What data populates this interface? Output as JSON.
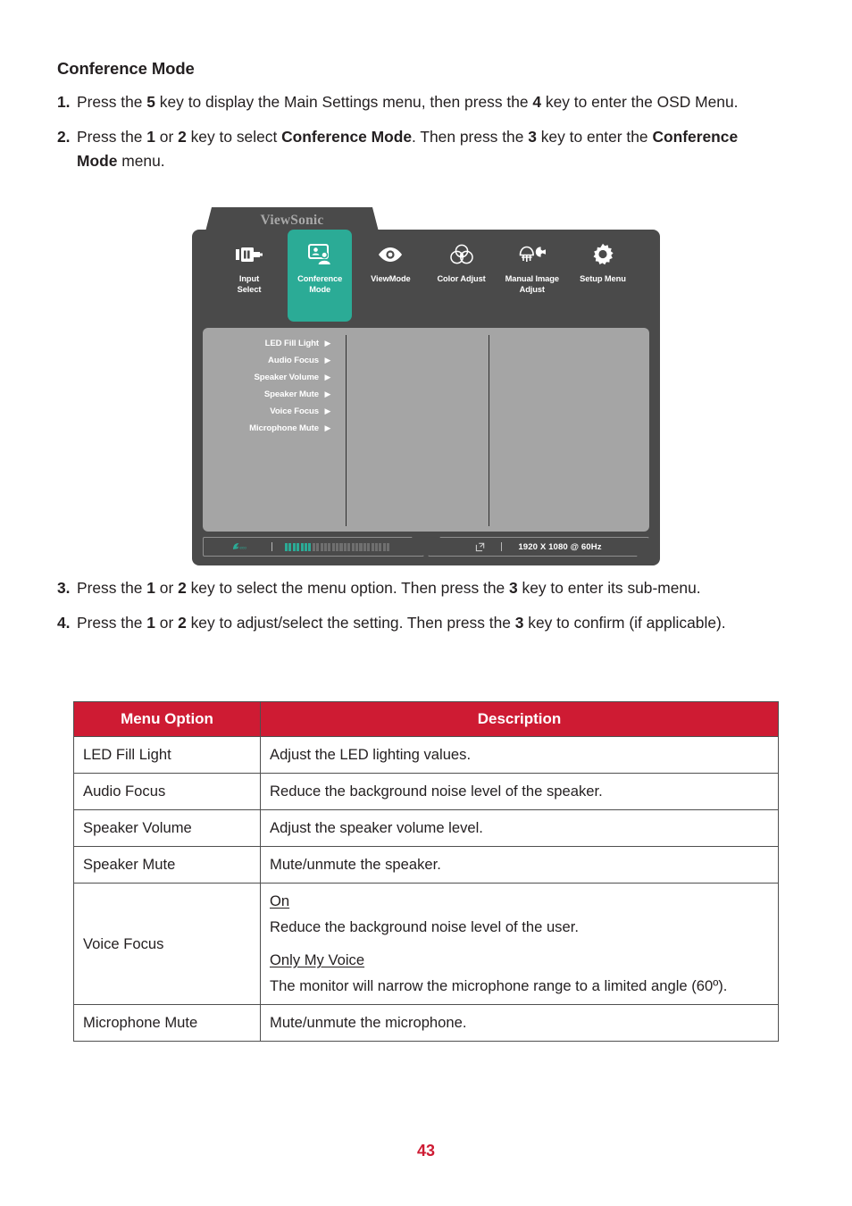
{
  "section": {
    "title": "Conference Mode"
  },
  "steps_top": [
    {
      "num": "1.",
      "parts": [
        {
          "t": "Press the ",
          "b": false
        },
        {
          "t": "5",
          "b": true
        },
        {
          "t": " key to display the Main Settings menu, then press the ",
          "b": false
        },
        {
          "t": "4",
          "b": true
        },
        {
          "t": " key to enter the OSD Menu.",
          "b": false
        }
      ]
    },
    {
      "num": "2.",
      "parts": [
        {
          "t": "Press the ",
          "b": false
        },
        {
          "t": "1",
          "b": true
        },
        {
          "t": " or ",
          "b": false
        },
        {
          "t": "2",
          "b": true
        },
        {
          "t": " key to select ",
          "b": false
        },
        {
          "t": "Conference Mode",
          "b": true
        },
        {
          "t": ". Then press the ",
          "b": false
        },
        {
          "t": "3",
          "b": true
        },
        {
          "t": " key to enter the ",
          "b": false
        },
        {
          "t": "Conference Mode",
          "b": true
        },
        {
          "t": " menu.",
          "b": false
        }
      ]
    }
  ],
  "steps_mid": [
    {
      "num": "3.",
      "parts": [
        {
          "t": "Press the ",
          "b": false
        },
        {
          "t": "1",
          "b": true
        },
        {
          "t": " or ",
          "b": false
        },
        {
          "t": "2",
          "b": true
        },
        {
          "t": " key to select the menu option. Then press the ",
          "b": false
        },
        {
          "t": "3",
          "b": true
        },
        {
          "t": " key to enter its sub-menu.",
          "b": false
        }
      ]
    },
    {
      "num": "4.",
      "parts": [
        {
          "t": "Press the ",
          "b": false
        },
        {
          "t": "1",
          "b": true
        },
        {
          "t": " or ",
          "b": false
        },
        {
          "t": "2",
          "b": true
        },
        {
          "t": " key to adjust/select the setting. Then press the ",
          "b": false
        },
        {
          "t": "3",
          "b": true
        },
        {
          "t": " key to confirm (if applicable).",
          "b": false
        }
      ]
    }
  ],
  "osd": {
    "brand": "ViewSonic",
    "accent_color": "#2bab96",
    "panel_color": "#a5a5a5",
    "chrome_color": "#4a4a4a",
    "tabs": [
      {
        "label": "Input\nSelect",
        "label_line1": "Input",
        "label_line2": "Select",
        "icon": "input-connector-icon",
        "active": false
      },
      {
        "label": "Conference\nMode",
        "label_line1": "Conference",
        "label_line2": "Mode",
        "icon": "conference-person-screen-icon",
        "active": true
      },
      {
        "label": "ViewMode",
        "label_line1": "ViewMode",
        "label_line2": "",
        "icon": "eye-icon",
        "active": false
      },
      {
        "label": "Color Adjust",
        "label_line1": "Color Adjust",
        "label_line2": "",
        "icon": "color-venn-circles-icon",
        "active": false
      },
      {
        "label": "Manual Image\nAdjust",
        "label_line1": "Manual Image",
        "label_line2": "Adjust",
        "icon": "brush-wrench-icon",
        "active": false
      },
      {
        "label": "Setup Menu",
        "label_line1": "Setup Menu",
        "label_line2": "",
        "icon": "gear-icon",
        "active": false
      }
    ],
    "menu_items": [
      {
        "label": "LED Fill Light",
        "arrow": "▶"
      },
      {
        "label": "Audio Focus",
        "arrow": "▶"
      },
      {
        "label": "Speaker Volume",
        "arrow": "▶"
      },
      {
        "label": "Speaker Mute",
        "arrow": "▶"
      },
      {
        "label": "Voice Focus",
        "arrow": "▶"
      },
      {
        "label": "Microphone Mute",
        "arrow": "▶"
      }
    ],
    "status": {
      "eco_icon": "eco-leaf-icon",
      "level_total": 27,
      "level_filled": 7,
      "exit_icon": "exit-arrow-icon",
      "resolution": "1920 X 1080 @ 60Hz"
    }
  },
  "table": {
    "header": {
      "option": "Menu Option",
      "description": "Description"
    },
    "header_bg": "#ce1b33",
    "rows": [
      {
        "option": "LED Fill Light",
        "blocks": [
          {
            "head": "",
            "text": "Adjust the LED lighting values."
          }
        ]
      },
      {
        "option": "Audio Focus",
        "blocks": [
          {
            "head": "",
            "text": "Reduce the background noise level of the speaker."
          }
        ]
      },
      {
        "option": "Speaker Volume",
        "blocks": [
          {
            "head": "",
            "text": "Adjust the speaker volume level."
          }
        ]
      },
      {
        "option": "Speaker Mute",
        "blocks": [
          {
            "head": "",
            "text": "Mute/unmute the speaker."
          }
        ]
      },
      {
        "option": "Voice Focus",
        "blocks": [
          {
            "head": "On",
            "text": "Reduce the background noise level of the user."
          },
          {
            "head": "Only My Voice",
            "text": "The monitor will narrow the microphone range to a limited angle (60º)."
          }
        ]
      },
      {
        "option": "Microphone Mute",
        "blocks": [
          {
            "head": "",
            "text": "Mute/unmute the microphone."
          }
        ]
      }
    ]
  },
  "footer": {
    "page_number": "43"
  }
}
